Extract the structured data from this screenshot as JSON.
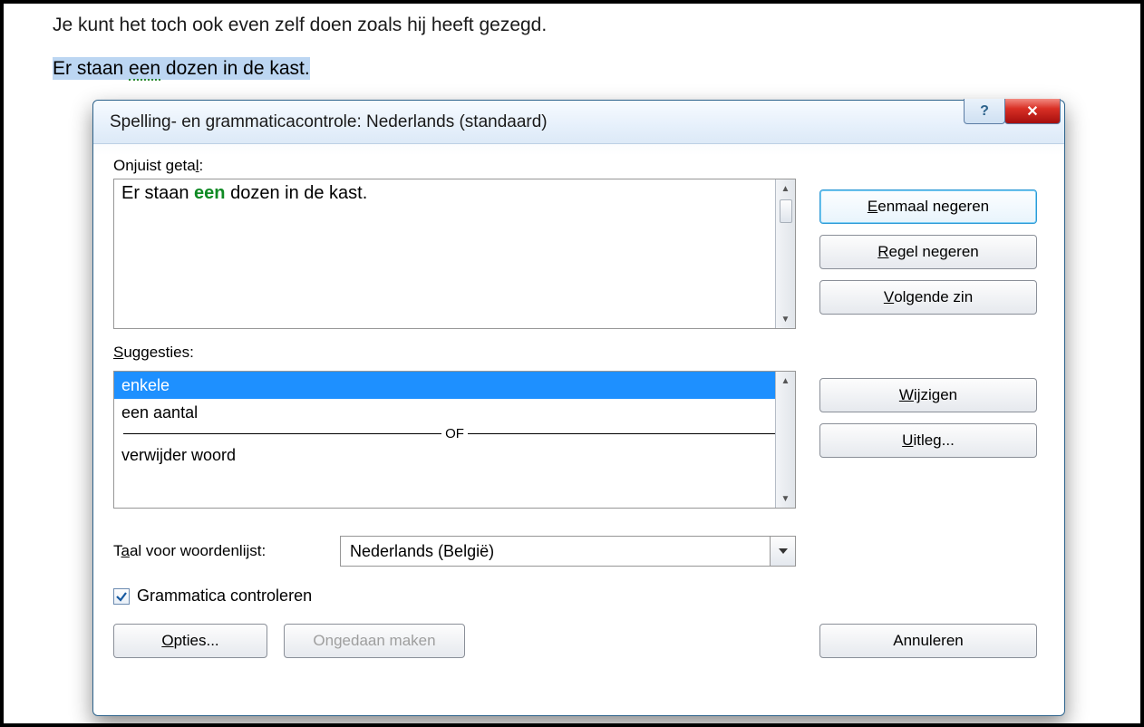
{
  "document": {
    "line1": "Je kunt het toch ook even zelf doen zoals hij heeft gezegd.",
    "line2_pre": "Er staan ",
    "line2_err": "een",
    "line2_post": " dozen in de kast."
  },
  "dialog": {
    "title": "Spelling- en grammaticacontrole: Nederlands (standaard)",
    "error_label_pre": "Onjuist geta",
    "error_label_ul": "l",
    "error_label_post": ":",
    "error_text_pre": "Er staan ",
    "error_text_err": "een",
    "error_text_post": " dozen in de kast.",
    "suggest_label_ul": "S",
    "suggest_label_post": "uggesties:",
    "suggestions": {
      "s1": "enkele",
      "s2": "een aantal",
      "of": "OF",
      "s3": "verwijder woord"
    },
    "lang_label_pre": "T",
    "lang_label_ul": "a",
    "lang_label_post": "al voor woordenlijst:",
    "lang_value": "Nederlands (België)",
    "check_label_pre": "Grammatica ",
    "check_label_ul": "c",
    "check_label_post": "ontroleren",
    "buttons": {
      "ignore_once_ul": "E",
      "ignore_once_post": "enmaal negeren",
      "ignore_rule_ul": "R",
      "ignore_rule_post": "egel negeren",
      "next_sentence_ul": "V",
      "next_sentence_post": "olgende zin",
      "change_ul": "W",
      "change_post": "ijzigen",
      "explain_ul": "U",
      "explain_post": "itleg...",
      "options_ul": "O",
      "options_post": "pties...",
      "undo": "Ongedaan maken",
      "cancel": "Annuleren"
    }
  }
}
